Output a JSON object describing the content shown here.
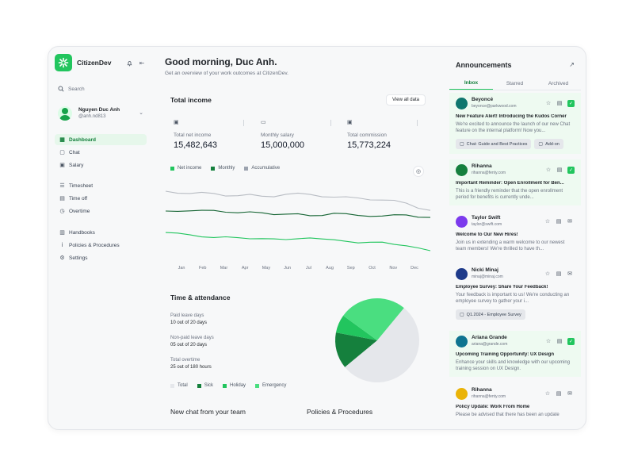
{
  "app": {
    "name": "CitizenDev"
  },
  "sidebar": {
    "search_label": "Search",
    "user": {
      "name": "Nguyen Duc Anh",
      "handle": "@anh.nd813"
    },
    "items": [
      {
        "label": "Dashboard",
        "icon": "dashboard-icon"
      },
      {
        "label": "Chat",
        "icon": "chat-icon"
      },
      {
        "label": "Salary",
        "icon": "salary-icon"
      },
      {
        "label": "Timesheet",
        "icon": "timesheet-icon"
      },
      {
        "label": "Time off",
        "icon": "time-off-icon"
      },
      {
        "label": "Overtime",
        "icon": "overtime-icon"
      },
      {
        "label": "Handbooks",
        "icon": "book-icon"
      },
      {
        "label": "Policies & Procedures",
        "icon": "policy-icon"
      },
      {
        "label": "Settings",
        "icon": "gear-icon"
      }
    ]
  },
  "header": {
    "greeting": "Good morning, Duc Anh.",
    "subtitle": "Get an overview of your work outcomes at CitizenDev."
  },
  "income": {
    "title": "Total income",
    "view_all": "View all data",
    "stats": [
      {
        "label": "Total net income",
        "value": "15,482,643"
      },
      {
        "label": "Monthly salary",
        "value": "15,000,000"
      },
      {
        "label": "Total commission",
        "value": "15,773,224"
      }
    ],
    "legend": [
      {
        "label": "Net income",
        "color": "#22c55e"
      },
      {
        "label": "Monthly",
        "color": "#15803d"
      },
      {
        "label": "Accumulative",
        "color": "#9ca3af"
      }
    ]
  },
  "time_attendance": {
    "title": "Time & attendance",
    "stats": [
      {
        "label": "Paid leave days",
        "value": "10 out of 20 days"
      },
      {
        "label": "Non-paid leave days",
        "value": "05 out of 20 days"
      },
      {
        "label": "Total overtime",
        "value": "25 out of 180 hours"
      }
    ],
    "legend": [
      {
        "label": "Total",
        "color": "#e5e7eb"
      },
      {
        "label": "Sick",
        "color": "#15803d"
      },
      {
        "label": "Holiday",
        "color": "#22c55e"
      },
      {
        "label": "Emergency",
        "color": "#4ade80"
      }
    ]
  },
  "sections": {
    "new_chat": "New chat from your team",
    "policies": "Policies & Procedures"
  },
  "announcements": {
    "title": "Announcements",
    "tabs": [
      "Inbox",
      "Starred",
      "Archived"
    ],
    "messages": [
      {
        "name": "Beyoncé",
        "email": "beyonce@parkwood.com",
        "subject": "New Feature Alert! Introducing the Kudos Corner",
        "body": "We're excited to announce the launch of our new Chat feature on the internal platform! Now you...",
        "attachments": [
          "Chat: Guide and Best Practices",
          "Add-on"
        ]
      },
      {
        "name": "Rihanna",
        "email": "rihanna@fenty.com",
        "subject": "Important Reminder: Open Enrollment for Ben...",
        "body": "This is a friendly reminder that the open enrollment period for benefits is currently unde...",
        "attachments": []
      },
      {
        "name": "Taylor Swift",
        "email": "taylor@swift.com",
        "subject": "Welcome to Our New Hires!",
        "body": "Join us in extending a warm welcome to our newest team members! We're thrilled to have th...",
        "attachments": []
      },
      {
        "name": "Nicki Minaj",
        "email": "minaj@minaj.com",
        "subject": "Employee Survey: Share Your Feedback!",
        "body": "Your feedback is important to us! We're conducting an employee survey to gather your i...",
        "attachments": [
          "Q1.2024 - Employee Survey"
        ]
      },
      {
        "name": "Ariana Grande",
        "email": "ariana@grande.com",
        "subject": "Upcoming Training Opportunity: UX Design",
        "body": "Enhance your skills and knowledge with our upcoming training session on UX Design.",
        "attachments": []
      },
      {
        "name": "Rihanna",
        "email": "rihanna@fenty.com",
        "subject": "Policy Update: Work From Home",
        "body": "Please be advised that there has been an update",
        "attachments": []
      }
    ]
  },
  "chart_data": [
    {
      "type": "line",
      "x": [
        "Jan",
        "Feb",
        "Mar",
        "Apr",
        "May",
        "Jun",
        "Jul",
        "Aug",
        "Sep",
        "Oct",
        "Nov",
        "Dec"
      ],
      "grid": false,
      "legend": "top-left",
      "series": [
        {
          "name": "Accumulative",
          "color": "#b8bcc3",
          "values": [
            88,
            86,
            84,
            83,
            82,
            83,
            85,
            80,
            79,
            78,
            72,
            64
          ]
        },
        {
          "name": "Monthly",
          "color": "#166534",
          "values": [
            64,
            63,
            63,
            62,
            60,
            59,
            58,
            59,
            58,
            57,
            57,
            56
          ]
        },
        {
          "name": "Net income",
          "color": "#22c55e",
          "values": [
            37,
            32,
            30,
            30,
            27,
            28,
            29,
            26,
            24,
            23,
            19,
            14
          ]
        }
      ]
    },
    {
      "type": "pie",
      "legend": "bottom-left",
      "categories": [
        "Total",
        "Sick",
        "Holiday",
        "Emergency"
      ],
      "values": [
        53,
        14,
        7,
        26
      ],
      "colors": [
        "#e5e7eb",
        "#15803d",
        "#22c55e",
        "#4ade80"
      ]
    }
  ]
}
